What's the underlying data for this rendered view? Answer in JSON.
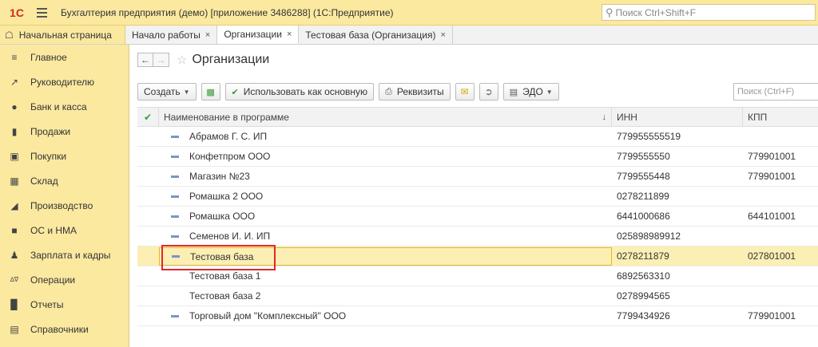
{
  "titlebar": {
    "logo": "1С",
    "title": "Бухгалтерия предприятия (демо) [приложение 3486288]  (1С:Предприятие)",
    "search_placeholder": "Поиск Ctrl+Shift+F"
  },
  "tabs": [
    {
      "label": "Начальная страница"
    },
    {
      "label": "Начало работы",
      "close": "×"
    },
    {
      "label": "Организации",
      "close": "×"
    },
    {
      "label": "Тестовая база (Организация)",
      "close": "×"
    }
  ],
  "sidebar": {
    "items": [
      {
        "label": "Главное",
        "icon": "menu-lines-icon"
      },
      {
        "label": "Руководителю",
        "icon": "trend-icon"
      },
      {
        "label": "Банк и касса",
        "icon": "coin-icon"
      },
      {
        "label": "Продажи",
        "icon": "bag-icon"
      },
      {
        "label": "Покупки",
        "icon": "cart-icon"
      },
      {
        "label": "Склад",
        "icon": "warehouse-icon"
      },
      {
        "label": "Производство",
        "icon": "factory-icon"
      },
      {
        "label": "ОС и НМА",
        "icon": "truck-icon"
      },
      {
        "label": "Зарплата и кадры",
        "icon": "person-icon"
      },
      {
        "label": "Операции",
        "icon": "operations-icon"
      },
      {
        "label": "Отчеты",
        "icon": "bar-chart-icon"
      },
      {
        "label": "Справочники",
        "icon": "book-icon"
      }
    ]
  },
  "main": {
    "title": "Организации",
    "toolbar": {
      "create": "Создать",
      "use_main": "Использовать как основную",
      "requisites": "Реквизиты",
      "edo": "ЭДО"
    },
    "search_placeholder": "Поиск (Ctrl+F)",
    "table": {
      "headers": {
        "name": "Наименование в программе",
        "inn": "ИНН",
        "kpp": "КПП"
      },
      "rows": [
        {
          "name": "Абрамов Г. С. ИП",
          "inn": "779955555519",
          "kpp": "",
          "icon": true
        },
        {
          "name": "Конфетпром ООО",
          "inn": "7799555550",
          "kpp": "779901001",
          "icon": true
        },
        {
          "name": "Магазин №23",
          "inn": "7799555448",
          "kpp": "779901001",
          "icon": true
        },
        {
          "name": "Ромашка 2 ООО",
          "inn": "0278211899",
          "kpp": "",
          "icon": true
        },
        {
          "name": "Ромашка ООО",
          "inn": "6441000686",
          "kpp": "644101001",
          "icon": true
        },
        {
          "name": "Семенов И. И. ИП",
          "inn": "025898989912",
          "kpp": "",
          "icon": true
        },
        {
          "name": "Тестовая база",
          "inn": "0278211879",
          "kpp": "027801001",
          "icon": true,
          "selected": true
        },
        {
          "name": "Тестовая база 1",
          "inn": "6892563310",
          "kpp": "",
          "icon": false
        },
        {
          "name": "Тестовая база 2",
          "inn": "0278994565",
          "kpp": "",
          "icon": false
        },
        {
          "name": "Торговый дом \"Комплексный\" ООО",
          "inn": "7799434926",
          "kpp": "779901001",
          "icon": true
        }
      ]
    }
  },
  "colors": {
    "accent_yellow": "#fbe9a0",
    "selection": "#fcefb3",
    "highlight_red": "#e0282a"
  }
}
